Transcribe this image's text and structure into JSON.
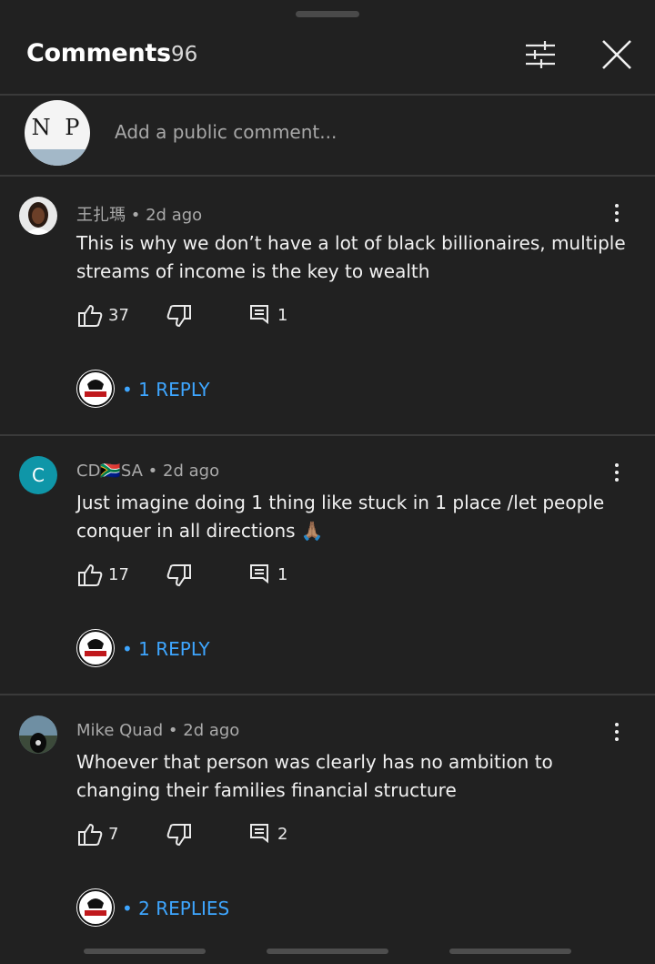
{
  "header": {
    "title": "Comments",
    "count": "96"
  },
  "composer": {
    "avatar_initials": "N P",
    "placeholder": "Add a public comment..."
  },
  "comments": [
    {
      "author": "王扎瑪",
      "time": "2d ago",
      "text": "This is why we don’t have a lot of black billionaires, multiple streams of income is the key to wealth",
      "likes": "37",
      "reply_count": "1",
      "replies_label": "1 REPLY"
    },
    {
      "author": "CD🇿🇦SA",
      "avatar_letter": "C",
      "time": "2d ago",
      "text": "Just imagine doing 1 thing like stuck in 1 place /let people conquer in all directions 🙏🏽",
      "likes": "17",
      "reply_count": "1",
      "replies_label": "1 REPLY"
    },
    {
      "author": "Mike Quad",
      "time": "2d ago",
      "text": "Whoever that person was clearly has no ambition to changing their families financial structure",
      "likes": "7",
      "reply_count": "2",
      "replies_label": "2 REPLIES"
    }
  ],
  "separator": "•",
  "colors": {
    "background": "#212121",
    "link": "#3ea6ff",
    "avatar_teal": "#0f96a8"
  },
  "icons": [
    "filter-icon",
    "close-icon",
    "more-vert-icon",
    "thumb-up-icon",
    "thumb-down-icon",
    "comment-icon"
  ]
}
